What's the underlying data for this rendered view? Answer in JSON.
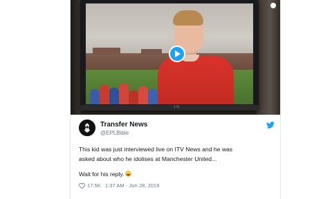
{
  "tweet": {
    "display_name": "Transfer News",
    "handle": "@EPLBible",
    "text_line1": "This kid was just interviewed live on ITV News and he was",
    "text_line2": "asked about who he idolises at Manchester United...",
    "text_line3": "Wait for his reply.",
    "like_count": "17.5K",
    "timestamp": "1:37 AM - Jun 28, 2019"
  },
  "media": {
    "tv_brand": "LG"
  },
  "icons": {
    "play": "play-icon",
    "twitter": "twitter-bird-icon",
    "heart": "heart-icon",
    "emoji": "tears-of-joy-emoji"
  },
  "colors": {
    "accent": "#1da1f2",
    "text": "#14171a",
    "muted": "#657786",
    "emoji": "#f7c23e"
  }
}
